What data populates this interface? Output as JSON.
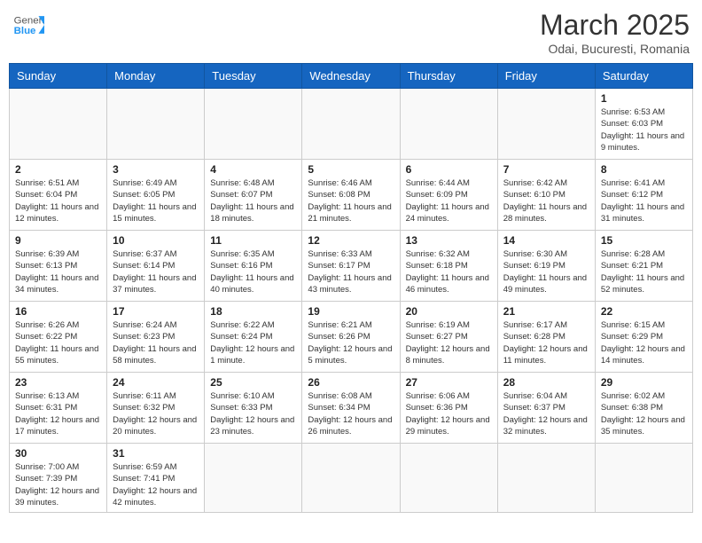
{
  "header": {
    "logo_general": "General",
    "logo_blue": "Blue",
    "month_title": "March 2025",
    "location": "Odai, Bucuresti, Romania"
  },
  "weekdays": [
    "Sunday",
    "Monday",
    "Tuesday",
    "Wednesday",
    "Thursday",
    "Friday",
    "Saturday"
  ],
  "days": [
    {
      "date": "",
      "info": ""
    },
    {
      "date": "",
      "info": ""
    },
    {
      "date": "",
      "info": ""
    },
    {
      "date": "",
      "info": ""
    },
    {
      "date": "",
      "info": ""
    },
    {
      "date": "",
      "info": ""
    },
    {
      "date": "1",
      "sunrise": "6:53 AM",
      "sunset": "6:03 PM",
      "daylight": "11 hours and 9 minutes."
    },
    {
      "date": "2",
      "sunrise": "6:51 AM",
      "sunset": "6:04 PM",
      "daylight": "11 hours and 12 minutes."
    },
    {
      "date": "3",
      "sunrise": "6:49 AM",
      "sunset": "6:05 PM",
      "daylight": "11 hours and 15 minutes."
    },
    {
      "date": "4",
      "sunrise": "6:48 AM",
      "sunset": "6:07 PM",
      "daylight": "11 hours and 18 minutes."
    },
    {
      "date": "5",
      "sunrise": "6:46 AM",
      "sunset": "6:08 PM",
      "daylight": "11 hours and 21 minutes."
    },
    {
      "date": "6",
      "sunrise": "6:44 AM",
      "sunset": "6:09 PM",
      "daylight": "11 hours and 24 minutes."
    },
    {
      "date": "7",
      "sunrise": "6:42 AM",
      "sunset": "6:10 PM",
      "daylight": "11 hours and 28 minutes."
    },
    {
      "date": "8",
      "sunrise": "6:41 AM",
      "sunset": "6:12 PM",
      "daylight": "11 hours and 31 minutes."
    },
    {
      "date": "9",
      "sunrise": "6:39 AM",
      "sunset": "6:13 PM",
      "daylight": "11 hours and 34 minutes."
    },
    {
      "date": "10",
      "sunrise": "6:37 AM",
      "sunset": "6:14 PM",
      "daylight": "11 hours and 37 minutes."
    },
    {
      "date": "11",
      "sunrise": "6:35 AM",
      "sunset": "6:16 PM",
      "daylight": "11 hours and 40 minutes."
    },
    {
      "date": "12",
      "sunrise": "6:33 AM",
      "sunset": "6:17 PM",
      "daylight": "11 hours and 43 minutes."
    },
    {
      "date": "13",
      "sunrise": "6:32 AM",
      "sunset": "6:18 PM",
      "daylight": "11 hours and 46 minutes."
    },
    {
      "date": "14",
      "sunrise": "6:30 AM",
      "sunset": "6:19 PM",
      "daylight": "11 hours and 49 minutes."
    },
    {
      "date": "15",
      "sunrise": "6:28 AM",
      "sunset": "6:21 PM",
      "daylight": "11 hours and 52 minutes."
    },
    {
      "date": "16",
      "sunrise": "6:26 AM",
      "sunset": "6:22 PM",
      "daylight": "11 hours and 55 minutes."
    },
    {
      "date": "17",
      "sunrise": "6:24 AM",
      "sunset": "6:23 PM",
      "daylight": "11 hours and 58 minutes."
    },
    {
      "date": "18",
      "sunrise": "6:22 AM",
      "sunset": "6:24 PM",
      "daylight": "12 hours and 1 minute."
    },
    {
      "date": "19",
      "sunrise": "6:21 AM",
      "sunset": "6:26 PM",
      "daylight": "12 hours and 5 minutes."
    },
    {
      "date": "20",
      "sunrise": "6:19 AM",
      "sunset": "6:27 PM",
      "daylight": "12 hours and 8 minutes."
    },
    {
      "date": "21",
      "sunrise": "6:17 AM",
      "sunset": "6:28 PM",
      "daylight": "12 hours and 11 minutes."
    },
    {
      "date": "22",
      "sunrise": "6:15 AM",
      "sunset": "6:29 PM",
      "daylight": "12 hours and 14 minutes."
    },
    {
      "date": "23",
      "sunrise": "6:13 AM",
      "sunset": "6:31 PM",
      "daylight": "12 hours and 17 minutes."
    },
    {
      "date": "24",
      "sunrise": "6:11 AM",
      "sunset": "6:32 PM",
      "daylight": "12 hours and 20 minutes."
    },
    {
      "date": "25",
      "sunrise": "6:10 AM",
      "sunset": "6:33 PM",
      "daylight": "12 hours and 23 minutes."
    },
    {
      "date": "26",
      "sunrise": "6:08 AM",
      "sunset": "6:34 PM",
      "daylight": "12 hours and 26 minutes."
    },
    {
      "date": "27",
      "sunrise": "6:06 AM",
      "sunset": "6:36 PM",
      "daylight": "12 hours and 29 minutes."
    },
    {
      "date": "28",
      "sunrise": "6:04 AM",
      "sunset": "6:37 PM",
      "daylight": "12 hours and 32 minutes."
    },
    {
      "date": "29",
      "sunrise": "6:02 AM",
      "sunset": "6:38 PM",
      "daylight": "12 hours and 35 minutes."
    },
    {
      "date": "30",
      "sunrise": "7:00 AM",
      "sunset": "7:39 PM",
      "daylight": "12 hours and 39 minutes."
    },
    {
      "date": "31",
      "sunrise": "6:59 AM",
      "sunset": "7:41 PM",
      "daylight": "12 hours and 42 minutes."
    }
  ],
  "labels": {
    "sunrise": "Sunrise:",
    "sunset": "Sunset:",
    "daylight": "Daylight:"
  }
}
